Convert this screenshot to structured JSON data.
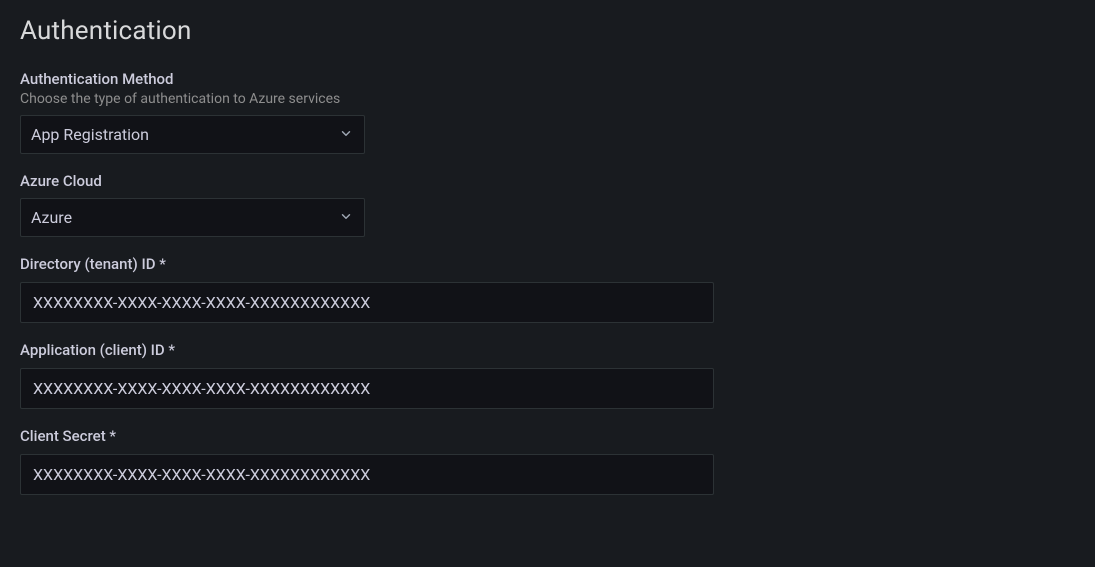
{
  "section": {
    "title": "Authentication"
  },
  "auth_method": {
    "label": "Authentication Method",
    "description": "Choose the type of authentication to Azure services",
    "value": "App Registration"
  },
  "azure_cloud": {
    "label": "Azure Cloud",
    "value": "Azure"
  },
  "tenant_id": {
    "label": "Directory (tenant) ID *",
    "placeholder": "XXXXXXXX-XXXX-XXXX-XXXX-XXXXXXXXXXXX",
    "value": ""
  },
  "client_id": {
    "label": "Application (client) ID *",
    "placeholder": "XXXXXXXX-XXXX-XXXX-XXXX-XXXXXXXXXXXX",
    "value": ""
  },
  "client_secret": {
    "label": "Client Secret *",
    "placeholder": "XXXXXXXX-XXXX-XXXX-XXXX-XXXXXXXXXXXX",
    "value": ""
  }
}
